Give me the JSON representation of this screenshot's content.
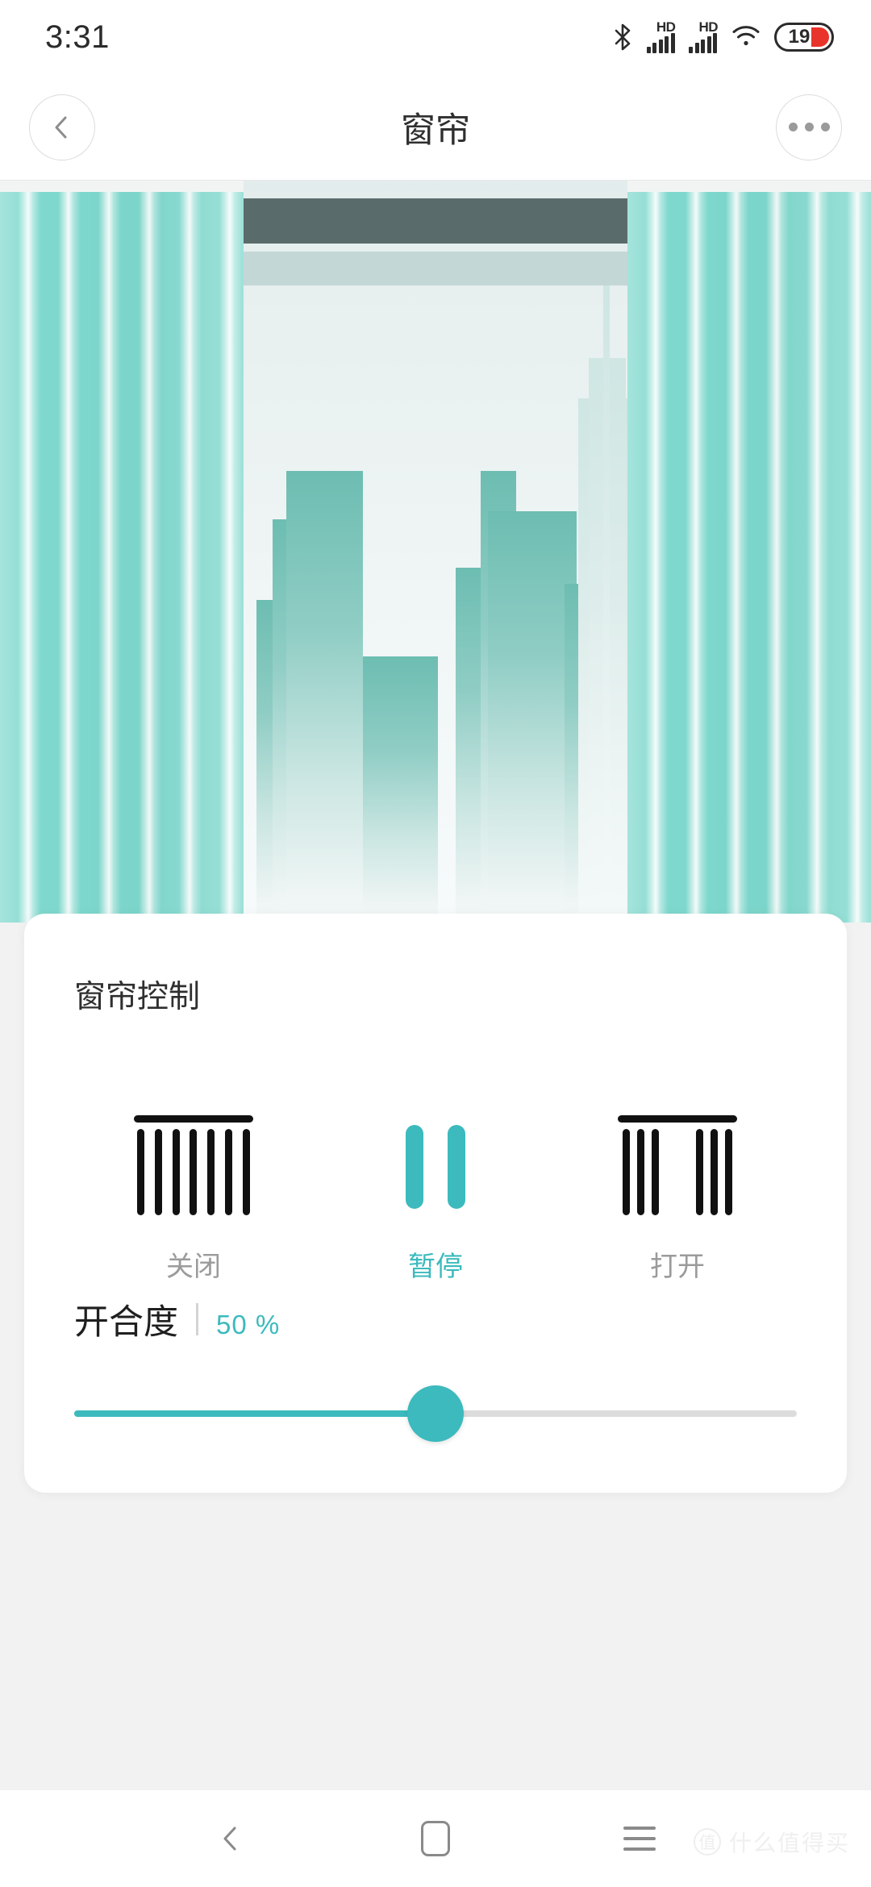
{
  "status_bar": {
    "clock": "3:31",
    "bluetooth_icon": "bluetooth-icon",
    "sim1": {
      "hd_label": "HD",
      "bars": 5
    },
    "sim2": {
      "hd_label": "HD",
      "bars": 5
    },
    "wifi_icon": "wifi-icon",
    "battery": {
      "percent": "19",
      "low": true,
      "color": "#e8342a"
    }
  },
  "header": {
    "title": "窗帘",
    "back_icon": "chevron-left-icon",
    "more_icon": "more-horizontal-icon"
  },
  "hero": {
    "alt": "curtain-illustration",
    "curtain_color": "#7ed8cd",
    "valance_color": "#5a6b6b",
    "building_color": "#6dbdb2"
  },
  "card": {
    "title": "窗帘控制",
    "modes": [
      {
        "id": "close",
        "label": "关闭",
        "icon": "curtain-closed-icon",
        "active": false
      },
      {
        "id": "pause",
        "label": "暂停",
        "icon": "pause-icon",
        "active": true
      },
      {
        "id": "open",
        "label": "打开",
        "icon": "curtain-open-icon",
        "active": false
      }
    ],
    "slider": {
      "label": "开合度",
      "value": "50",
      "unit": "%",
      "value_text": "50 %",
      "percent": 50,
      "min": 0,
      "max": 100,
      "accent": "#3cbabd"
    }
  },
  "nav_bar": {
    "back_icon": "nav-back-icon",
    "home_icon": "nav-home-icon",
    "menu_icon": "nav-menu-icon"
  },
  "watermark": {
    "badge": "值",
    "text": "什么值得买"
  }
}
